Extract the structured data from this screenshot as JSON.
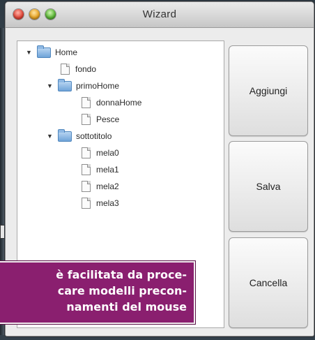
{
  "window": {
    "title": "Wizard"
  },
  "tree": [
    {
      "label": "Home",
      "type": "folder",
      "expanded": true,
      "level": 0
    },
    {
      "label": "fondo",
      "type": "file",
      "level": 1
    },
    {
      "label": "primoHome",
      "type": "folder",
      "expanded": true,
      "level": 1
    },
    {
      "label": "donnaHome",
      "type": "file",
      "level": 2
    },
    {
      "label": "Pesce",
      "type": "file",
      "level": 2
    },
    {
      "label": "sottotitolo",
      "type": "folder",
      "expanded": true,
      "level": 1
    },
    {
      "label": "mela0",
      "type": "file",
      "level": 2
    },
    {
      "label": "mela1",
      "type": "file",
      "level": 2
    },
    {
      "label": "mela2",
      "type": "file",
      "level": 2
    },
    {
      "label": "mela3",
      "type": "file",
      "level": 2
    }
  ],
  "buttons": {
    "add_label": "Aggiungi",
    "save_label": "Salva",
    "cancel_label": "Cancella"
  },
  "caption": {
    "line1": "è facilitata da proce-",
    "line2": "care modelli precon-",
    "line3": "namenti del mouse"
  },
  "colors": {
    "caption_bg": "#8a1f6f",
    "window_bg": "#ececec",
    "folder_icon": "#6fa3d8"
  }
}
